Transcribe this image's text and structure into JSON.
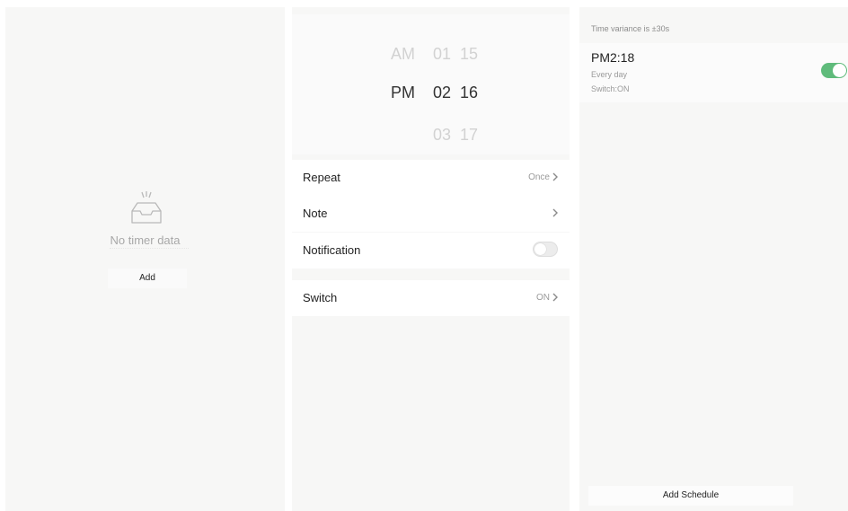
{
  "timer_list": {
    "empty_text": "No timer data",
    "add_label": "Add",
    "empty_icon": "empty-inbox-icon"
  },
  "picker": {
    "ampm": [
      "AM",
      "PM"
    ],
    "hours": [
      "01",
      "02",
      "03"
    ],
    "minutes": [
      "15",
      "16",
      "17"
    ],
    "selected": {
      "ampm": "PM",
      "hour": "02",
      "minute": "16"
    }
  },
  "settings": {
    "repeat": {
      "label": "Repeat",
      "value": "Once"
    },
    "note": {
      "label": "Note"
    },
    "notification": {
      "label": "Notification",
      "enabled": false
    },
    "switch": {
      "label": "Switch",
      "value": "ON"
    }
  },
  "schedules": {
    "variance_note": "Time variance is ±30s",
    "items": [
      {
        "time": "PM2:18",
        "repeat": "Every day",
        "switch": "Switch:ON",
        "enabled": true
      }
    ],
    "add_label": "Add Schedule"
  },
  "colors": {
    "panel_bg": "#f7f7f6",
    "accent_green": "#5fbb7b",
    "muted_text": "#9a9a9a"
  }
}
